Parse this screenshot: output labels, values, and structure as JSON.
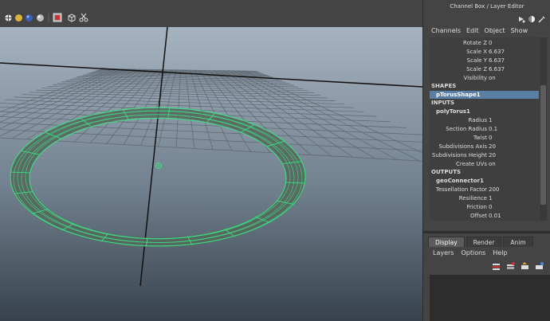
{
  "panel": {
    "title": "Channel Box / Layer Editor",
    "menu": [
      "Channels",
      "Edit",
      "Object",
      "Show"
    ]
  },
  "transform_rows": [
    {
      "label": "Rotate Z",
      "value": "0"
    },
    {
      "label": "Scale X",
      "value": "6.637"
    },
    {
      "label": "Scale Y",
      "value": "6.637"
    },
    {
      "label": "Scale Z",
      "value": "6.637"
    },
    {
      "label": "Visibility",
      "value": "on"
    }
  ],
  "shapes": {
    "header": "SHAPES",
    "node": "pTorusShape1"
  },
  "inputs": {
    "header": "INPUTS",
    "node": "polyTorus1",
    "rows": [
      {
        "label": "Radius",
        "value": "1"
      },
      {
        "label": "Section Radius",
        "value": "0.1"
      },
      {
        "label": "Twist",
        "value": "0"
      },
      {
        "label": "Subdivisions Axis",
        "value": "20"
      },
      {
        "label": "Subdivisions Height",
        "value": "20"
      },
      {
        "label": "Create UVs",
        "value": "on"
      }
    ]
  },
  "outputs": {
    "header": "OUTPUTS",
    "node": "geoConnector1",
    "rows": [
      {
        "label": "Tessellation Factor",
        "value": "200"
      },
      {
        "label": "Resilience",
        "value": "1"
      },
      {
        "label": "Friction",
        "value": "0"
      },
      {
        "label": "Offset",
        "value": "0.01"
      }
    ]
  },
  "layer_editor": {
    "tabs": [
      "Display",
      "Render",
      "Anim"
    ],
    "active_tab": "Display",
    "menu": [
      "Layers",
      "Options",
      "Help"
    ]
  },
  "toolbar_icons": [
    "light-bulb-icon",
    "shaded-sphere-icon",
    "textured-sphere-icon",
    "grid-toggle-icon",
    "isolate-select-icon",
    "cube-icon",
    "scissors-icon"
  ],
  "colors": {
    "wireframe": "#3ddc84",
    "selection": "#5a7fa6"
  }
}
